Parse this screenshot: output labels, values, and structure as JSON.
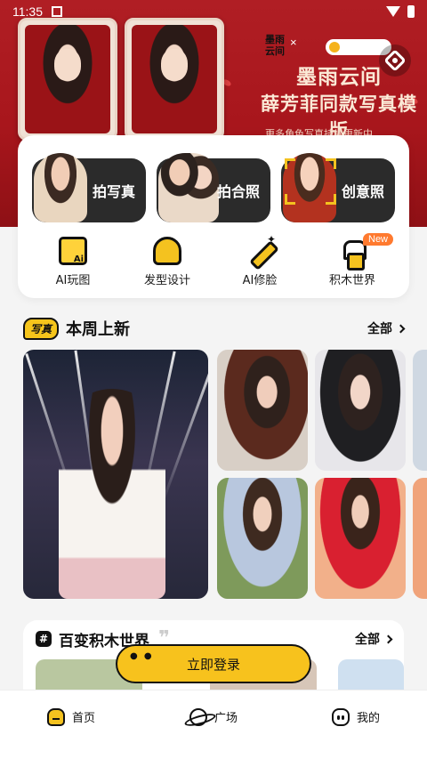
{
  "status_bar": {
    "time": "11:35"
  },
  "banner": {
    "title_line1": "墨雨云间",
    "title_line2": "薛芳菲同款写真模版",
    "subtitle": "更多角色写真持续更新中...",
    "logo_text": "墨雨云间",
    "x_mark": "×"
  },
  "actions": {
    "buttons": [
      {
        "label": "拍写真"
      },
      {
        "label": "拍合照"
      },
      {
        "label": "创意照"
      }
    ],
    "tools": [
      {
        "label": "AI玩图",
        "icon": "ai-picture-icon"
      },
      {
        "label": "发型设计",
        "icon": "hairstyle-icon"
      },
      {
        "label": "AI修脸",
        "icon": "magic-wand-icon"
      },
      {
        "label": "积木世界",
        "icon": "blocks-icon",
        "badge": "New"
      }
    ]
  },
  "weekly": {
    "tag": "写真",
    "title": "本周上新",
    "all_label": "全部"
  },
  "blocks_section": {
    "title": "百变积木世界",
    "all_label": "全部"
  },
  "login_button": "立即登录",
  "bottom_nav": [
    {
      "label": "首页",
      "icon": "home-icon"
    },
    {
      "label": "广场",
      "icon": "planet-icon"
    },
    {
      "label": "我的",
      "icon": "profile-face-icon"
    }
  ],
  "colors": {
    "accent": "#f6c51b",
    "banner_red": "#b01e24",
    "badge_orange": "#ff7a2f"
  }
}
